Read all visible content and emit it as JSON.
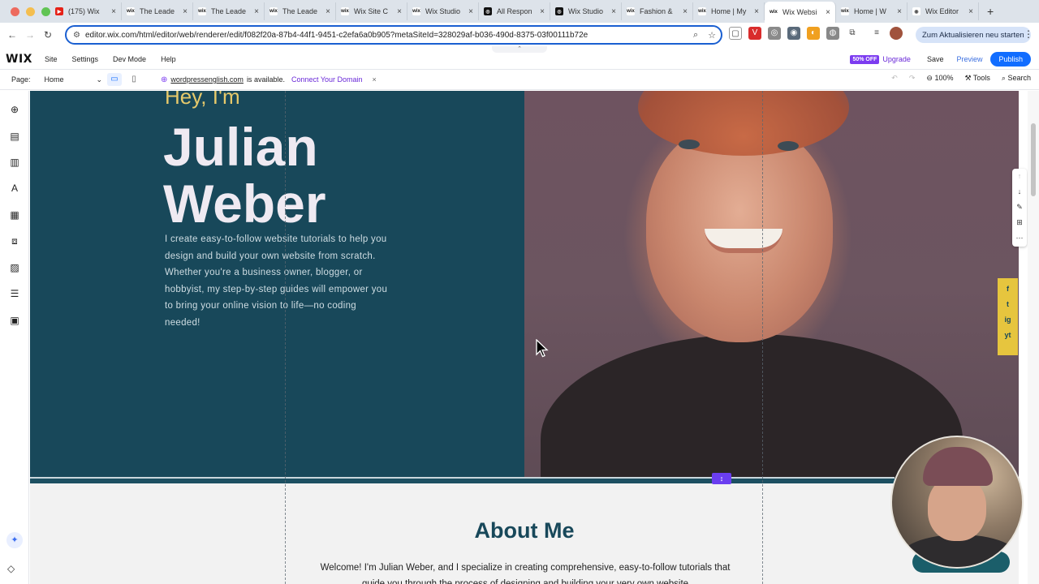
{
  "browser": {
    "tabs": [
      {
        "title": "(175) Wix",
        "fav": "yt"
      },
      {
        "title": "The Leade",
        "fav": "wix"
      },
      {
        "title": "The Leade",
        "fav": "wix"
      },
      {
        "title": "The Leade",
        "fav": "wix"
      },
      {
        "title": "Wix Site C",
        "fav": "wix"
      },
      {
        "title": "Wix Studio",
        "fav": "wix"
      },
      {
        "title": "All Respon",
        "fav": "gpt"
      },
      {
        "title": "Wix Studio",
        "fav": "gpt"
      },
      {
        "title": "Fashion &",
        "fav": "wix"
      },
      {
        "title": "Home | My",
        "fav": "wix"
      },
      {
        "title": "Wix Websi",
        "fav": "wix",
        "active": true
      },
      {
        "title": "Home | W",
        "fav": "wix"
      },
      {
        "title": "Wix Editor",
        "fav": "globe"
      }
    ],
    "url": "editor.wix.com/html/editor/web/renderer/edit/f082f20a-87b4-44f1-9451-c2efa6a0b905?metaSiteId=328029af-b036-490d-8375-03f00111b72e",
    "update_label": "Zum Aktualisieren neu starten"
  },
  "wix_topbar": {
    "logo": "WIX",
    "menu": [
      "Site",
      "Settings",
      "Dev Mode",
      "Help"
    ],
    "off_badge": "50% OFF",
    "upgrade": "Upgrade",
    "save": "Save",
    "preview": "Preview",
    "publish": "Publish"
  },
  "wix_bar2": {
    "page_label": "Page:",
    "page_value": "Home",
    "domain": "wordpressenglish.com",
    "domain_msg": "is available.",
    "connect": "Connect Your Domain",
    "zoom": "100%",
    "tools": "Tools",
    "search": "Search"
  },
  "hero": {
    "greeting": "Hey, I'm",
    "name_line1": "Julian",
    "name_line2": "Weber",
    "intro": "I create easy-to-follow website tutorials to help you design and build your own website from scratch. Whether you're a business owner, blogger, or hobbyist, my step-by-step guides will empower you to bring your online vision to life—no coding needed!"
  },
  "about": {
    "title": "About Me",
    "text": "Welcome! I'm Julian Weber, and I specialize in creating comprehensive, easy-to-follow tutorials that guide you through the process of designing and building your very own website"
  },
  "social": [
    "f",
    "t",
    "ig",
    "yt"
  ],
  "colors": {
    "hero_bg": "#18485a",
    "accent_yellow": "#e6c96b",
    "publish_blue": "#116dff",
    "upgrade_purple": "#6a29d8"
  }
}
